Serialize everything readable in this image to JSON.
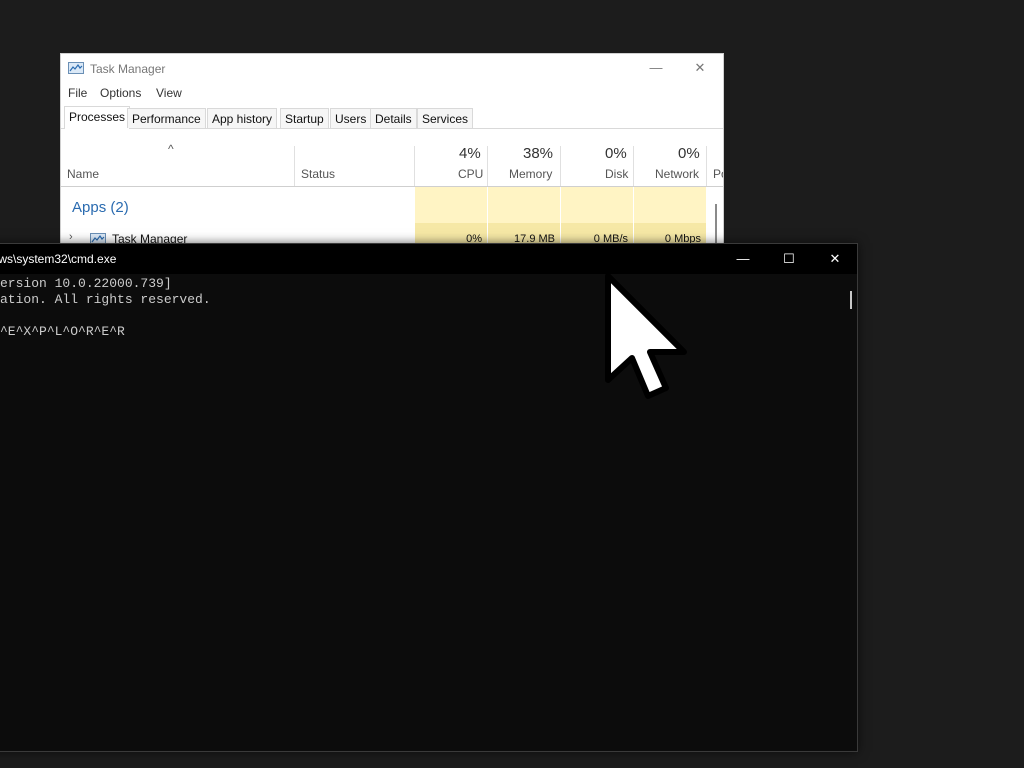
{
  "task_manager": {
    "title": "Task Manager",
    "window_controls": {
      "minimize": "—",
      "maximize": "☐",
      "close": "✕"
    },
    "menu": [
      "File",
      "Options",
      "View"
    ],
    "tabs": [
      "Processes",
      "Performance",
      "App history",
      "Startup",
      "Users",
      "Details",
      "Services"
    ],
    "active_tab": "Processes",
    "columns": {
      "name": "Name",
      "status": "Status",
      "cpu": {
        "label": "CPU",
        "percent": "4%"
      },
      "memory": {
        "label": "Memory",
        "percent": "38%"
      },
      "disk": {
        "label": "Disk",
        "percent": "0%"
      },
      "network": {
        "label": "Network",
        "percent": "0%"
      },
      "power": "Po"
    },
    "sort_indicator": "^",
    "group": {
      "label": "Apps (2)"
    },
    "row": {
      "name": "Task Manager",
      "cpu": "0%",
      "memory": "17.9 MB",
      "disk": "0 MB/s",
      "network": "0 Mbps"
    }
  },
  "cmd": {
    "title": "\\Windows\\system32\\cmd.exe",
    "window_controls": {
      "minimize": "—",
      "maximize": "☐",
      "close": "✕"
    },
    "lines": [
      "ws [Version 10.0.22000.739]",
      "orporation. All rights reserved.",
      "",
      "em32>^E^X^P^L^O^R^E^R"
    ]
  },
  "colors": {
    "desktop": "#1c1c1c",
    "cmd_background": "#0c0c0c",
    "apps_group": "#2a6bb0",
    "heat_light": "#fff4c4",
    "heat_dark": "#f6e8a6"
  }
}
